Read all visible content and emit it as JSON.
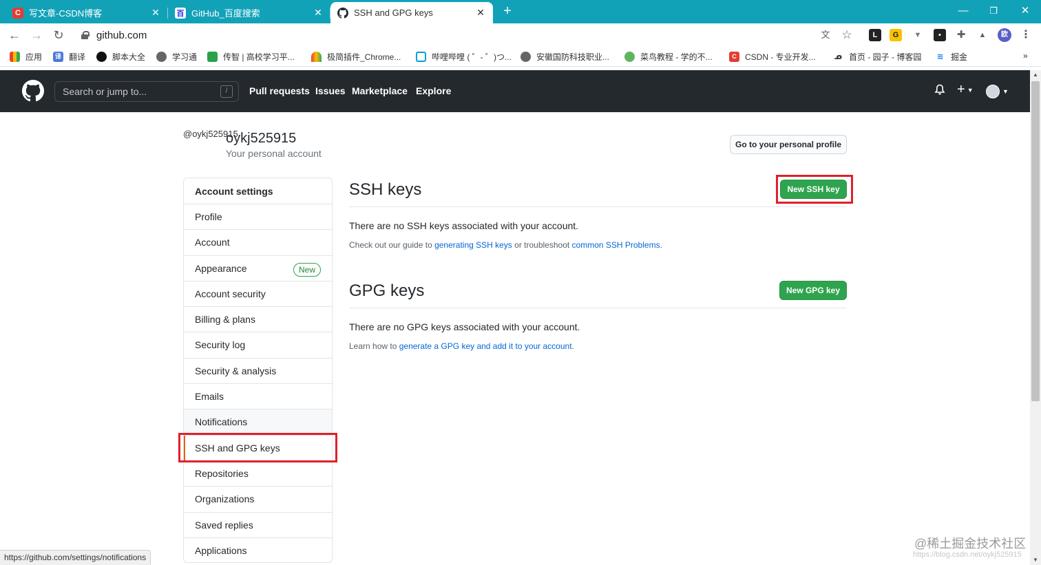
{
  "browser": {
    "tabs": [
      {
        "title": "写文章-CSDN博客",
        "icon": "csdn-icon"
      },
      {
        "title": "GitHub_百度搜索",
        "icon": "baidu-icon"
      },
      {
        "title": "SSH and GPG keys",
        "icon": "github-icon",
        "active": true
      }
    ],
    "url": "github.com",
    "profile_initial": "欧",
    "bookmarks": [
      "应用",
      "翻译",
      "脚本大全",
      "学习通",
      "传智 | 高校学习平...",
      "极简插件_Chrome...",
      "哔哩哔哩 ( ゜- ゜)つ...",
      "安徽国防科技职业...",
      "菜鸟教程 - 学的不...",
      "CSDN - 专业开发...",
      "首页 - 园子 - 博客园",
      "掘金"
    ],
    "bookmarks_overflow": "»"
  },
  "github": {
    "search_placeholder": "Search or jump to...",
    "search_hotkey": "/",
    "nav": [
      "Pull requests",
      "Issues",
      "Marketplace",
      "Explore"
    ]
  },
  "profile": {
    "avatar_alt": "@oykj525915",
    "username": "oykj525915",
    "subtitle": "Your personal account",
    "profile_button": "Go to your personal profile"
  },
  "sidebar": {
    "heading": "Account settings",
    "items": [
      {
        "label": "Profile"
      },
      {
        "label": "Account"
      },
      {
        "label": "Appearance",
        "badge": "New"
      },
      {
        "label": "Account security"
      },
      {
        "label": "Billing & plans"
      },
      {
        "label": "Security log"
      },
      {
        "label": "Security & analysis"
      },
      {
        "label": "Emails"
      },
      {
        "label": "Notifications"
      },
      {
        "label": "SSH and GPG keys",
        "selected": true
      },
      {
        "label": "Repositories"
      },
      {
        "label": "Organizations"
      },
      {
        "label": "Saved replies"
      },
      {
        "label": "Applications"
      }
    ]
  },
  "ssh": {
    "title": "SSH keys",
    "button": "New SSH key",
    "empty": "There are no SSH keys associated with your account.",
    "note_prefix": "Check out our guide to ",
    "link1": "generating SSH keys",
    "note_mid": " or troubleshoot ",
    "link2": "common SSH Problems",
    "note_suffix": "."
  },
  "gpg": {
    "title": "GPG keys",
    "button": "New GPG key",
    "empty": "There are no GPG keys associated with your account.",
    "note_prefix": "Learn how to ",
    "link": "generate a GPG key and add it to your account",
    "note_suffix": "."
  },
  "status_url": "https://github.com/settings/notifications",
  "watermark": "@稀土掘金技术社区",
  "watermark_sub": "https://blog.csdn.net/oykj525915",
  "colors": {
    "tabstrip": "#12a2b8",
    "github_header": "#24292e",
    "primary_button": "#2ea44f",
    "highlight": "#e0202a",
    "selected_marker": "#e36209"
  }
}
